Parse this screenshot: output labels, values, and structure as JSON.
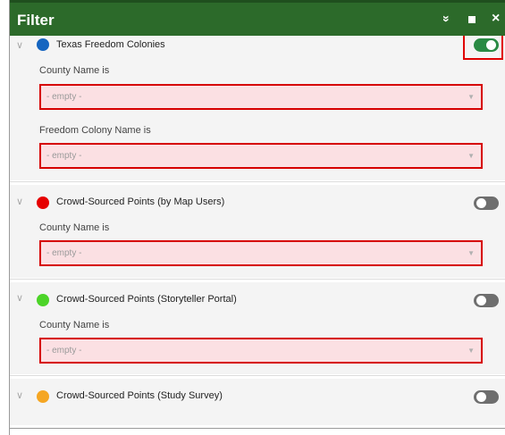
{
  "header": {
    "title": "Filter",
    "collapse_icon": "double-chevron-down-icon",
    "maximize_icon": "maximize-icon",
    "close_icon": "close-icon"
  },
  "layers": [
    {
      "name": "Texas Freedom Colonies",
      "dot_color": "#1565c0",
      "toggle": "on",
      "filters": [
        {
          "label": "County Name is",
          "value": "- empty -"
        },
        {
          "label": "Freedom Colony Name is",
          "value": "- empty -"
        }
      ]
    },
    {
      "name": "Crowd-Sourced Points (by Map Users)",
      "dot_color": "#e60000",
      "toggle": "off",
      "filters": [
        {
          "label": "County Name is",
          "value": "- empty -"
        }
      ]
    },
    {
      "name": "Crowd-Sourced Points (Storyteller Portal)",
      "dot_color": "#4cd428",
      "toggle": "off",
      "filters": [
        {
          "label": "County Name is",
          "value": "- empty -"
        }
      ]
    },
    {
      "name": "Crowd-Sourced Points (Study Survey)",
      "dot_color": "#f5a623",
      "toggle": "off",
      "filters": []
    }
  ],
  "colors": {
    "header_bg": "#2c6a2a",
    "highlight": "#e00000",
    "toggle_on": "#2a8a44",
    "toggle_off": "#6e6e6e"
  }
}
